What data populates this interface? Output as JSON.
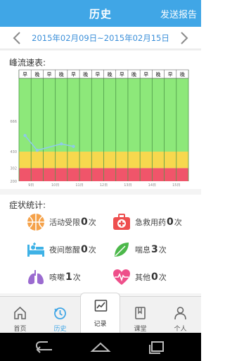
{
  "header": {
    "title": "历史",
    "send_report": "发送报告"
  },
  "date_range": {
    "text": "2015年02月09日~2015年02月15日",
    "prev_icon": "chevron-left-icon",
    "next_icon": "chevron-right-icon"
  },
  "peak_flow": {
    "label": "峰流速表:",
    "chart_data": {
      "type": "line",
      "title": "",
      "slot_labels": [
        "早",
        "晚",
        "早",
        "晚",
        "早",
        "晚",
        "早",
        "晚",
        "早",
        "晚",
        "早",
        "晚",
        "早",
        "晚"
      ],
      "x_tick_labels": [
        "9日",
        "10日",
        "11日",
        "12日",
        "13日",
        "14日",
        "15日"
      ],
      "y_ticks": [
        200,
        302,
        430,
        666
      ],
      "ylim": [
        200,
        1000
      ],
      "zones": [
        {
          "name": "red",
          "from": 200,
          "to": 302,
          "color": "#f0556a"
        },
        {
          "name": "yellow",
          "from": 302,
          "to": 430,
          "color": "#f7d84e"
        },
        {
          "name": "green",
          "from": 430,
          "to": 1000,
          "color": "#8de87a"
        }
      ],
      "series": [
        {
          "values": [
            555,
            440,
            490,
            470
          ],
          "slots": [
            0,
            1,
            3,
            4
          ],
          "color": "#8ecbe8"
        }
      ]
    }
  },
  "symptoms": {
    "label": "症状统计:",
    "items": [
      {
        "label": "活动受限",
        "count": "0",
        "unit": "次",
        "icon": "basketball-icon",
        "color": "#f5a24a"
      },
      {
        "label": "急救用药",
        "count": "0",
        "unit": "次",
        "icon": "first-aid-kit-icon",
        "color": "#ee4f4f"
      },
      {
        "label": "夜间憋醒",
        "count": "0",
        "unit": "次",
        "icon": "bed-icon",
        "color": "#3fb2e6"
      },
      {
        "label": "喘息",
        "count": "3",
        "unit": "次",
        "icon": "leaf-icon",
        "color": "#4cb84a"
      },
      {
        "label": "咳嗽",
        "count": "1",
        "unit": "次",
        "icon": "lungs-icon",
        "color": "#9b6bd0"
      },
      {
        "label": "其他",
        "count": "0",
        "unit": "次",
        "icon": "heart-pulse-icon",
        "color": "#ee4f8a"
      }
    ]
  },
  "tabs": [
    {
      "label": "首页",
      "icon": "home-icon"
    },
    {
      "label": "历史",
      "icon": "history-icon"
    },
    {
      "label": "记录",
      "icon": "chart-record-icon"
    },
    {
      "label": "课堂",
      "icon": "book-icon"
    },
    {
      "label": "个人",
      "icon": "person-icon"
    }
  ],
  "colors": {
    "brand": "#40a6e6"
  }
}
